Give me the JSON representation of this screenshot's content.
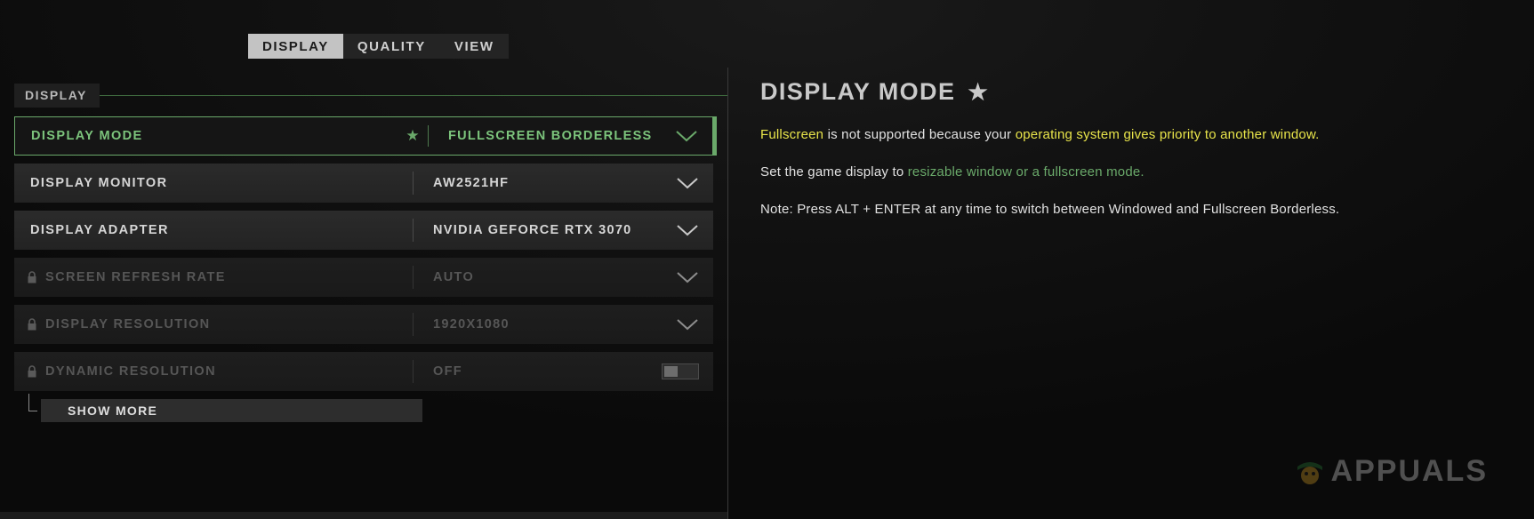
{
  "tabs": [
    {
      "label": "DISPLAY",
      "active": true
    },
    {
      "label": "QUALITY",
      "active": false
    },
    {
      "label": "VIEW",
      "active": false
    }
  ],
  "section": {
    "title": "DISPLAY"
  },
  "settings_rows": [
    {
      "label": "DISPLAY MODE",
      "value": "FULLSCREEN BORDERLESS",
      "control": "dropdown",
      "selected": true,
      "locked": false,
      "favorite": true,
      "star": "★"
    },
    {
      "label": "DISPLAY MONITOR",
      "value": "AW2521HF",
      "control": "dropdown",
      "selected": false,
      "locked": false,
      "favorite": false
    },
    {
      "label": "DISPLAY ADAPTER",
      "value": "NVIDIA GEFORCE RTX 3070",
      "control": "dropdown",
      "selected": false,
      "locked": false,
      "favorite": false
    },
    {
      "label": "SCREEN REFRESH RATE",
      "value": "AUTO",
      "control": "dropdown",
      "selected": false,
      "locked": true,
      "favorite": false
    },
    {
      "label": "DISPLAY RESOLUTION",
      "value": "1920X1080",
      "control": "dropdown",
      "selected": false,
      "locked": true,
      "favorite": false
    },
    {
      "label": "DYNAMIC RESOLUTION",
      "value": "OFF",
      "control": "toggle",
      "selected": false,
      "locked": true,
      "favorite": false
    }
  ],
  "show_more": {
    "label": "SHOW MORE"
  },
  "detail": {
    "title": "DISPLAY MODE",
    "star": "★",
    "paragraph1": {
      "part1": "Fullscreen",
      "part2": " is not supported because your ",
      "part3": "operating system gives priority to another window."
    },
    "paragraph2": {
      "part1": "Set the game display to ",
      "part2": "resizable window or a fullscreen mode."
    },
    "paragraph3": "Note: Press ALT + ENTER at any time to switch between Windowed and Fullscreen Borderless."
  },
  "watermark": {
    "text": "APPUALS"
  },
  "colors": {
    "accent_green": "#6aa96a",
    "accent_yellow": "#e8e44a",
    "panel_bg": "#121212",
    "row_bg": "#272727",
    "tab_active_bg": "#c3c3c3"
  }
}
